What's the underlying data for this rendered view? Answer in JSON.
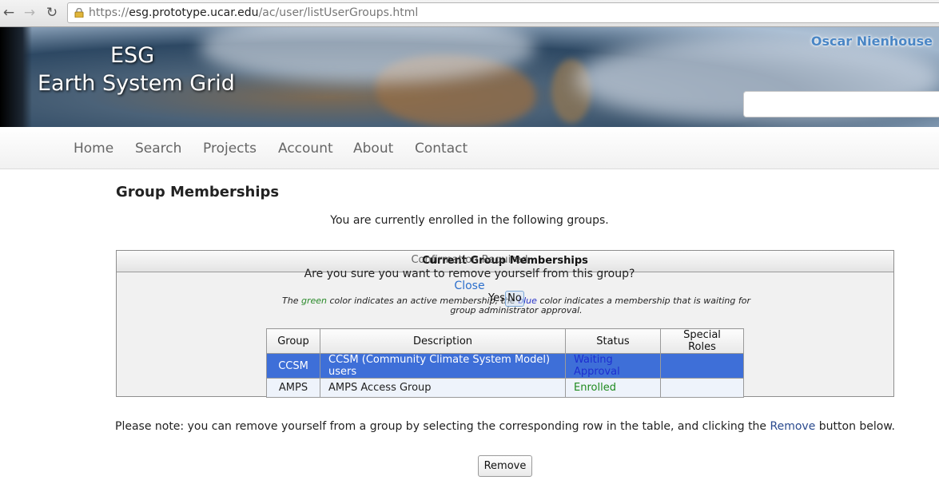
{
  "browser": {
    "url_scheme": "https://",
    "url_host": "esg.prototype.ucar.edu",
    "url_path": "/ac/user/listUserGroups.html",
    "back_glyph": "←",
    "forward_glyph": "→",
    "reload_glyph": "↻"
  },
  "banner": {
    "line1": "ESG",
    "line2": "Earth System Grid",
    "user_name": "Oscar Nienhouse"
  },
  "nav": [
    "Home",
    "Search",
    "Projects",
    "Account",
    "About",
    "Contact"
  ],
  "page": {
    "title": "Group Memberships",
    "intro": "You are currently enrolled in the following groups."
  },
  "panel": {
    "title": "Current Group Memberships",
    "legend_prefix": "The ",
    "legend_green": "green",
    "legend_mid": " color indicates an active membership, the ",
    "legend_blue": "blue",
    "legend_suffix": " color indicates a membership that is waiting for group administrator approval."
  },
  "confirm": {
    "title": "Confirmation Required",
    "question": "Are you sure you want to remove yourself from this group?",
    "close": "Close",
    "yes": "Yes",
    "no": "No"
  },
  "table": {
    "headers": [
      "Group",
      "Description",
      "Status",
      "Special Roles"
    ],
    "rows": [
      {
        "group": "CCSM",
        "description": "CCSM (Community Climate System Model) users",
        "status": "Waiting Approval",
        "roles": ""
      },
      {
        "group": "AMPS",
        "description": "AMPS Access Group",
        "status": "Enrolled",
        "roles": ""
      }
    ]
  },
  "note": {
    "prefix": "Please note: you can remove yourself from a group by selecting the corresponding row in the table, and clicking the ",
    "link": "Remove",
    "suffix": " button below."
  },
  "remove_button": "Remove",
  "colors": {
    "active": "#2a8a2a",
    "pending": "#2a35c8",
    "selected_row": "#3e6fd8",
    "link": "#2c6fcc"
  }
}
